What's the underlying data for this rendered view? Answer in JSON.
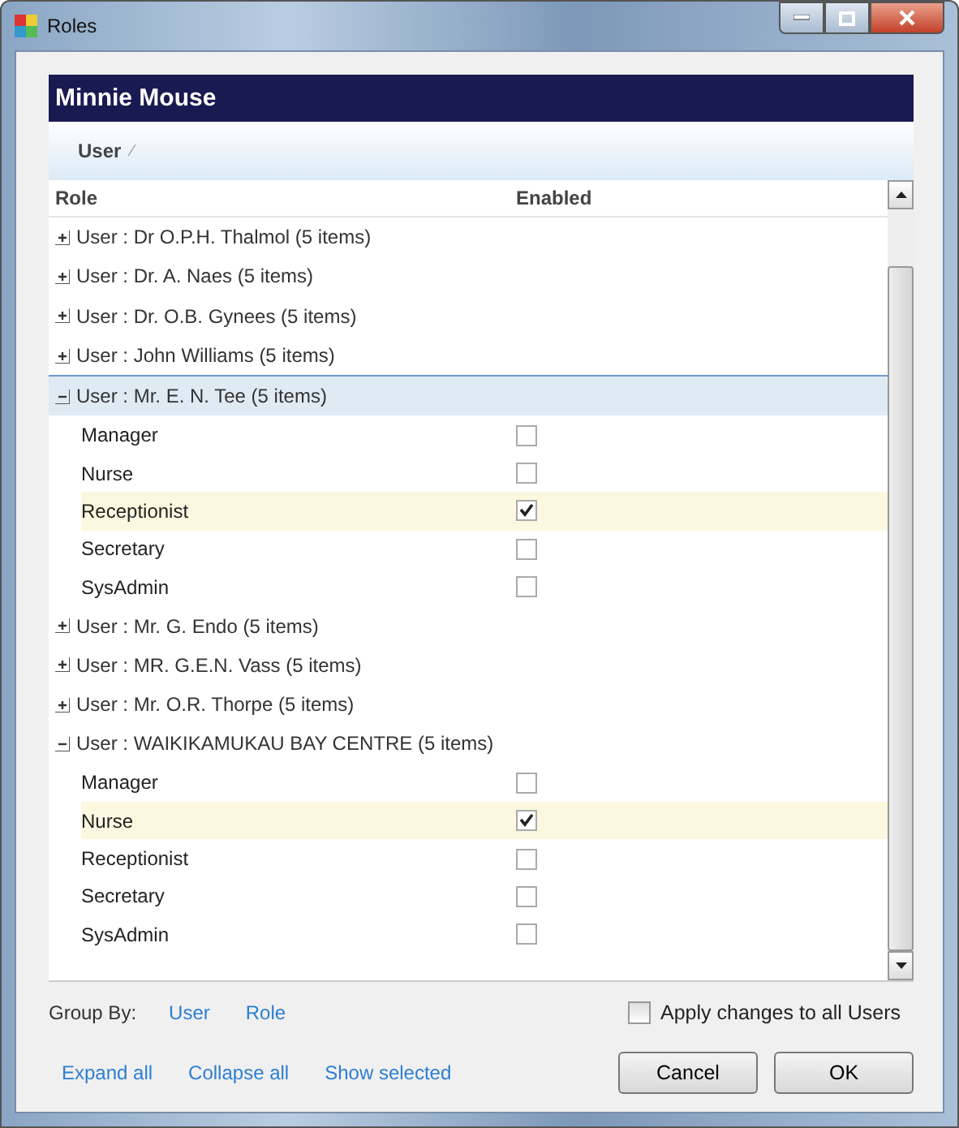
{
  "window": {
    "title": "Roles"
  },
  "header": {
    "title": "Minnie Mouse"
  },
  "group_panel": {
    "chip": "User",
    "sort_mark": "⁄"
  },
  "table": {
    "columns": [
      "Role",
      "Enabled"
    ],
    "groups": [
      {
        "label": "User : Dr O.P.H. Thalmol (5 items)",
        "expanded": false,
        "selected": false
      },
      {
        "label": "User : Dr. A. Naes (5 items)",
        "expanded": false,
        "selected": false
      },
      {
        "label": "User : Dr. O.B. Gynees (5 items)",
        "expanded": false,
        "selected": false
      },
      {
        "label": "User : John Williams (5 items)",
        "expanded": false,
        "selected": false
      },
      {
        "label": "User : Mr. E. N. Tee (5 items)",
        "expanded": true,
        "selected": true,
        "rows": [
          {
            "role": "Manager",
            "checked": false,
            "selected": false
          },
          {
            "role": "Nurse",
            "checked": false,
            "selected": false
          },
          {
            "role": "Receptionist",
            "checked": true,
            "selected": true
          },
          {
            "role": "Secretary",
            "checked": false,
            "selected": false
          },
          {
            "role": "SysAdmin",
            "checked": false,
            "selected": false
          }
        ]
      },
      {
        "label": "User : Mr. G. Endo (5 items)",
        "expanded": false,
        "selected": false
      },
      {
        "label": "User : MR. G.E.N. Vass (5 items)",
        "expanded": false,
        "selected": false
      },
      {
        "label": "User : Mr. O.R. Thorpe (5 items)",
        "expanded": false,
        "selected": false
      },
      {
        "label": "User : WAIKIKAMUKAU BAY CENTRE (5 items)",
        "expanded": true,
        "selected": false,
        "rows": [
          {
            "role": "Manager",
            "checked": false,
            "selected": false
          },
          {
            "role": "Nurse",
            "checked": true,
            "selected": true
          },
          {
            "role": "Receptionist",
            "checked": false,
            "selected": false
          },
          {
            "role": "Secretary",
            "checked": false,
            "selected": false
          },
          {
            "role": "SysAdmin",
            "checked": false,
            "selected": false
          }
        ]
      }
    ]
  },
  "group_by": {
    "label": "Group By:",
    "links": [
      "User",
      "Role"
    ]
  },
  "apply_all": {
    "label": "Apply changes to all Users",
    "checked": false
  },
  "links": [
    "Expand all",
    "Collapse all",
    "Show selected"
  ],
  "buttons": [
    "Cancel",
    "OK"
  ]
}
